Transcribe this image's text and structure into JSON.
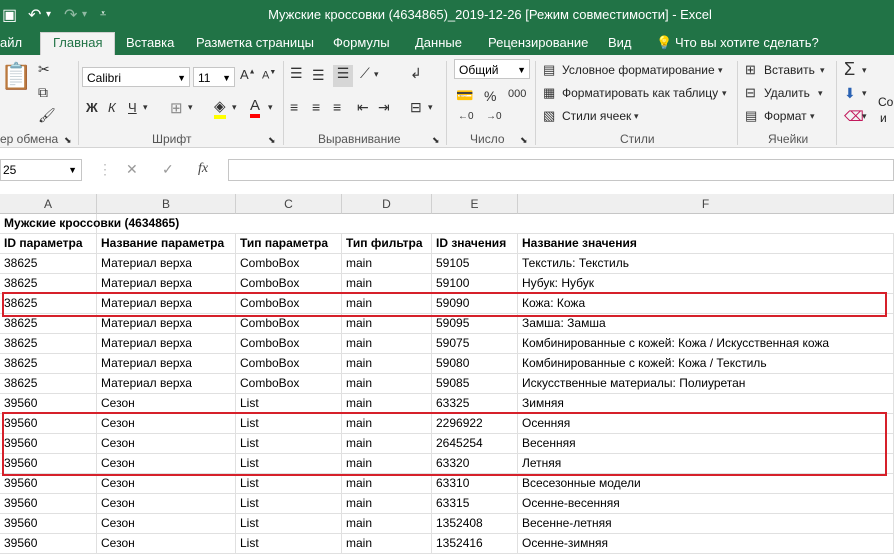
{
  "window": {
    "title": "Мужские кроссовки (4634865)_2019-12-26  [Режим совместимости]  -  Excel",
    "qa_icons": [
      "save-icon",
      "undo-icon",
      "redo-icon",
      "customize-qat-icon"
    ]
  },
  "tabs": [
    "айл",
    "Главная",
    "Вставка",
    "Разметка страницы",
    "Формулы",
    "Данные",
    "Рецензирование",
    "Вид"
  ],
  "tell_me": "Что вы хотите сделать?",
  "ribbon": {
    "clipboard": {
      "label": "ер обмена"
    },
    "font": {
      "name": "Calibri",
      "size": "11",
      "bold": "Ж",
      "italic": "К",
      "underline": "Ч",
      "label": "Шрифт"
    },
    "alignment": {
      "label": "Выравнивание"
    },
    "number": {
      "format": "Общий",
      "label": "Число"
    },
    "styles": {
      "conditional": "Условное форматирование",
      "as_table": "Форматировать как таблицу",
      "cell_styles": "Стили ячеек",
      "label": "Стили"
    },
    "cells": {
      "insert": "Вставить",
      "delete": "Удалить",
      "format": "Формат",
      "label": "Ячейки"
    },
    "editing": {
      "text": "Со",
      "text2": "и"
    }
  },
  "formula_bar": {
    "name_box": "25",
    "fx": "fx",
    "content": ""
  },
  "columns": [
    "A",
    "B",
    "C",
    "D",
    "E",
    "F"
  ],
  "sheet": {
    "title_row": "Мужские кроссовки (4634865)",
    "headers": [
      "ID параметра",
      "Название параметра",
      "Тип параметра",
      "Тип фильтра",
      "ID значения",
      "Название значения"
    ],
    "rows": [
      [
        "38625",
        "Материал верха",
        "ComboBox",
        "main",
        "59105",
        "Текстиль: Текстиль"
      ],
      [
        "38625",
        "Материал верха",
        "ComboBox",
        "main",
        "59100",
        "Нубук: Нубук"
      ],
      [
        "38625",
        "Материал верха",
        "ComboBox",
        "main",
        "59090",
        "Кожа: Кожа"
      ],
      [
        "38625",
        "Материал верха",
        "ComboBox",
        "main",
        "59095",
        "Замша: Замша"
      ],
      [
        "38625",
        "Материал верха",
        "ComboBox",
        "main",
        "59075",
        "Комбинированные с кожей: Кожа / Искусственная кожа"
      ],
      [
        "38625",
        "Материал верха",
        "ComboBox",
        "main",
        "59080",
        "Комбинированные с кожей: Кожа / Текстиль"
      ],
      [
        "38625",
        "Материал верха",
        "ComboBox",
        "main",
        "59085",
        "Искусственные материалы: Полиуретан"
      ],
      [
        "39560",
        "Сезон",
        "List",
        "main",
        "63325",
        "Зимняя"
      ],
      [
        "39560",
        "Сезон",
        "List",
        "main",
        "2296922",
        "Осенняя"
      ],
      [
        "39560",
        "Сезон",
        "List",
        "main",
        "2645254",
        "Весенняя"
      ],
      [
        "39560",
        "Сезон",
        "List",
        "main",
        "63320",
        "Летняя"
      ],
      [
        "39560",
        "Сезон",
        "List",
        "main",
        "63310",
        "Всесезонные модели"
      ],
      [
        "39560",
        "Сезон",
        "List",
        "main",
        "63315",
        "Осенне-весенняя"
      ],
      [
        "39560",
        "Сезон",
        "List",
        "main",
        "1352408",
        "Весенне-летняя"
      ],
      [
        "39560",
        "Сезон",
        "List",
        "main",
        "1352416",
        "Осенне-зимняя"
      ]
    ]
  },
  "colors": {
    "excel_green": "#217346",
    "highlight": "#d6202a"
  }
}
